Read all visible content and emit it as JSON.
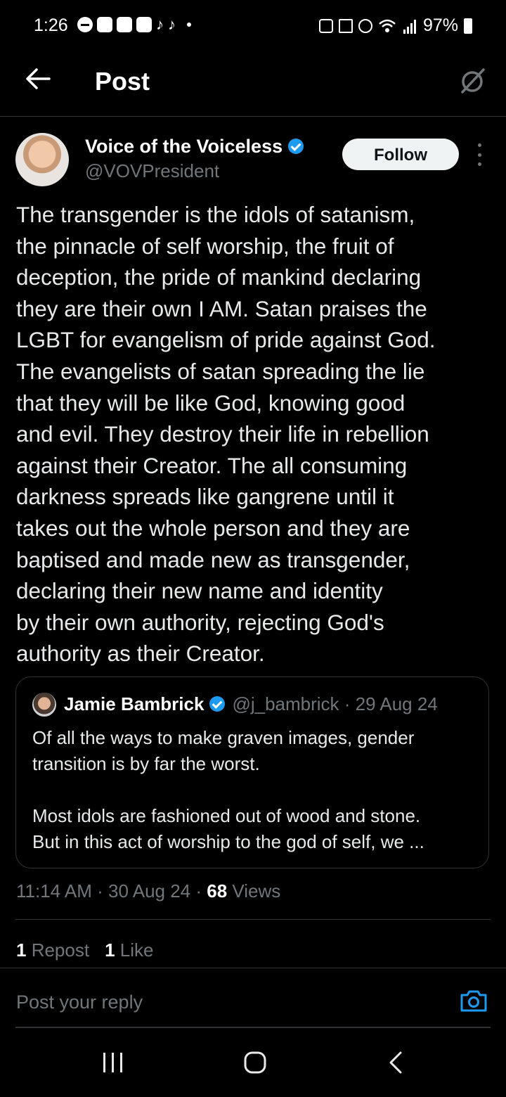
{
  "status_bar": {
    "time": "1:26",
    "battery": "97%"
  },
  "header": {
    "title": "Post",
    "back_icon": "arrow-left-icon",
    "right_icon": "grok-icon"
  },
  "post": {
    "author_name": "Voice of the Voiceless",
    "author_handle": "@VOVPresident",
    "follow_label": "Follow",
    "body": "The transgender is the idols of satanism,\nthe pinnacle of self worship, the fruit of\ndeception, the pride of mankind declaring\nthey are their own I AM. Satan praises the\nLGBT for evangelism of pride against God.\nThe evangelists of satan spreading the lie\nthat they will be like God, knowing good\nand evil. They destroy their life in rebellion\nagainst their Creator. The all consuming\ndarkness spreads like gangrene until it\ntakes out the whole person and they are\nbaptised and made new as transgender,\ndeclaring their new name and identity\nby their own authority, rejecting God's\nauthority as their Creator.",
    "quote": {
      "name": "Jamie Bambrick",
      "meta": "@j_bambrick · 29 Aug 24",
      "text": "Of all the ways to make graven images, gender\ntransition is by far the worst.\n\nMost idols are fashioned out of wood and stone.\nBut in this act of worship to the god of self, we ..."
    },
    "time": "11:14 AM · 30 Aug 24 · ",
    "views_count": "68",
    "views_label": " Views",
    "reposts_count": "1",
    "reposts_label": " Repost",
    "likes_count": "1",
    "likes_label": " Like"
  },
  "reply": {
    "placeholder": "Post your reply"
  },
  "colors": {
    "background": "#000000",
    "text": "#e7e9ea",
    "muted": "#71767b",
    "accent": "#1d9bf0",
    "divider": "#2f3336"
  }
}
